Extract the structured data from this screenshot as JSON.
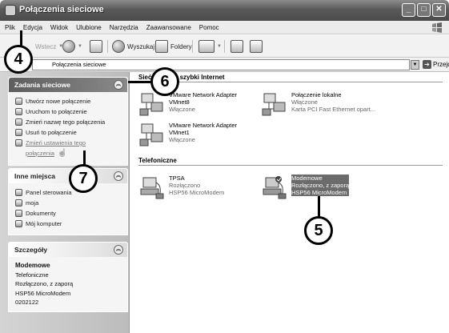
{
  "window": {
    "title": "Połączenia sieciowe"
  },
  "menu": [
    "Plik",
    "Edycja",
    "Widok",
    "Ulubione",
    "Narzędzia",
    "Zaawansowane",
    "Pomoc"
  ],
  "toolbar": {
    "back": "Wstecz",
    "search": "Wyszukaj",
    "folders": "Foldery"
  },
  "address": {
    "value": "Połączenia sieciowe",
    "go_label": "Przejdź"
  },
  "sidebar": {
    "tasks": {
      "title": "Zadania sieciowe",
      "items": [
        "Utwórz nowe połączenie",
        "Uruchom to połączenie",
        "Zmień nazwę tego połączenia",
        "Usuń to połączenie",
        "Zmień ustawienia tego",
        "połączenia"
      ]
    },
    "places": {
      "title": "Inne miejsca",
      "items": [
        "Panel sterowania",
        "moja",
        "Dokumenty",
        "Mój komputer"
      ]
    },
    "details": {
      "title": "Szczegóły",
      "lines": [
        "Modemowe",
        "Telefoniczne",
        "Rozłączono, z zaporą",
        "HSP56 MicroModem",
        "0202122"
      ]
    }
  },
  "content": {
    "groups": [
      {
        "title": "Sieć LAN lub szybki Internet"
      },
      {
        "title": "Telefoniczne"
      }
    ],
    "lan_items": [
      {
        "name": "VMware Network Adapter",
        "name2": "VMnet8",
        "status": "Włączone",
        "device": ""
      },
      {
        "name": "Połączenie lokalne",
        "name2": "",
        "status": "Włączone",
        "device": "Karta PCI Fast Ethernet opart..."
      },
      {
        "name": "VMware Network Adapter",
        "name2": "VMnet1",
        "status": "Włączone",
        "device": ""
      }
    ],
    "dialup_items": [
      {
        "name": "TPSA",
        "status": "Rozłączono",
        "device": "HSP56 MicroModem"
      },
      {
        "name": "Modemowe",
        "status": "Rozłączono, z zaporą",
        "device": "HSP56 MicroModem"
      }
    ]
  },
  "callouts": [
    "4",
    "5",
    "6",
    "7"
  ]
}
